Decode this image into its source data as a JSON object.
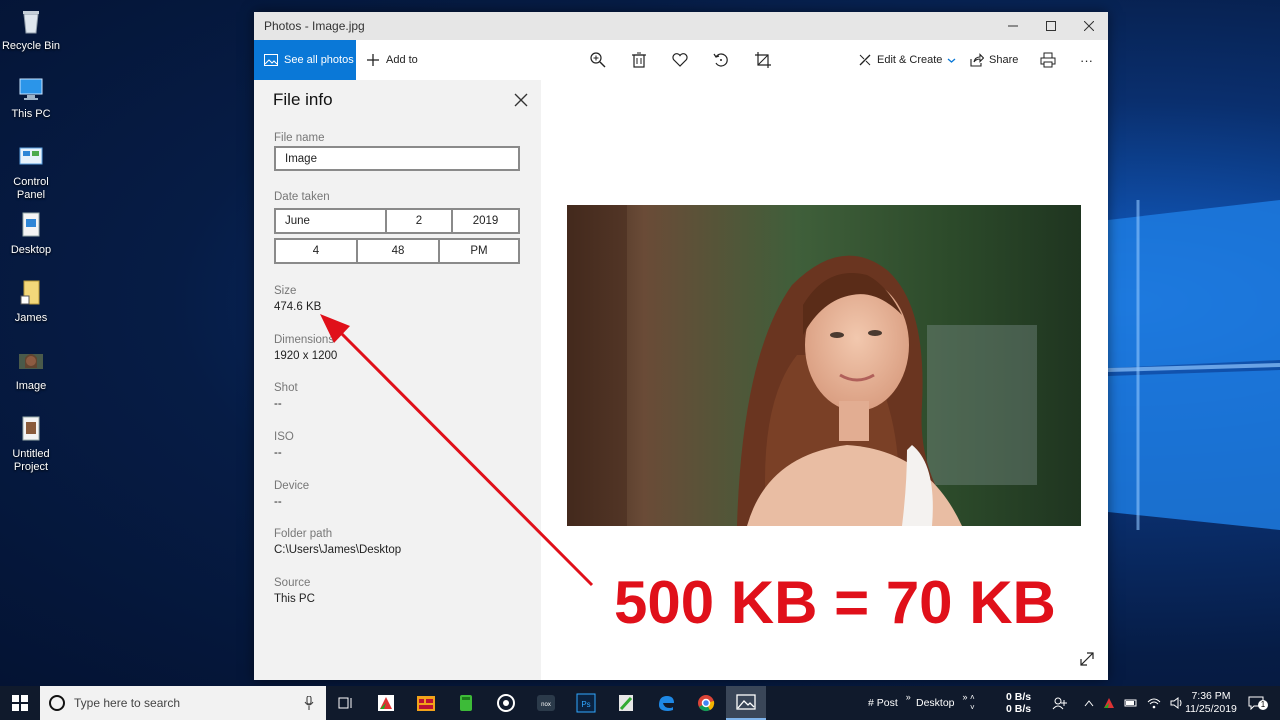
{
  "desktop_icons": [
    {
      "label": "Recycle Bin",
      "icon": "recycle-bin-icon"
    },
    {
      "label": "This PC",
      "icon": "this-pc-icon"
    },
    {
      "label": "Control Panel",
      "icon": "control-panel-icon"
    },
    {
      "label": "Desktop",
      "icon": "desktop-folder-icon"
    },
    {
      "label": "James",
      "icon": "user-folder-icon"
    },
    {
      "label": "Image",
      "icon": "image-file-icon"
    },
    {
      "label": "Untitled Project",
      "icon": "project-file-icon"
    }
  ],
  "window": {
    "title": "Photos - Image.jpg",
    "toolbar": {
      "see_all": "See all photos",
      "add_to": "Add to",
      "edit_create": "Edit & Create",
      "share": "Share",
      "more": "···"
    }
  },
  "file_info": {
    "heading": "File info",
    "file_name_label": "File name",
    "file_name_value": "Image",
    "date_taken_label": "Date taken",
    "date": {
      "month": "June",
      "day": "2",
      "year": "2019"
    },
    "time": {
      "hour": "4",
      "minute": "48",
      "ampm": "PM"
    },
    "size_label": "Size",
    "size_value": "474.6 KB",
    "dimensions_label": "Dimensions",
    "dimensions_value": "1920 x 1200",
    "shot_label": "Shot",
    "shot_value": "--",
    "iso_label": "ISO",
    "iso_value": "--",
    "device_label": "Device",
    "device_value": "--",
    "folder_label": "Folder path",
    "folder_value": "C:\\Users\\James\\Desktop",
    "source_label": "Source",
    "source_value": "This PC"
  },
  "overlay": {
    "text": "500 KB = 70 KB",
    "color": "#e0101a"
  },
  "taskbar": {
    "search_placeholder": "Type here to search",
    "tray": {
      "post_label": "# Post",
      "desktop_label": "Desktop",
      "net_up": "0 B/s",
      "net_down": "0 B/s",
      "time": "7:36 PM",
      "date": "11/25/2019",
      "notification_count": "1"
    }
  },
  "colors": {
    "accent": "#0a78d7",
    "panel_bg": "#f2f2f2",
    "taskbar_bg": "#101a2c"
  }
}
